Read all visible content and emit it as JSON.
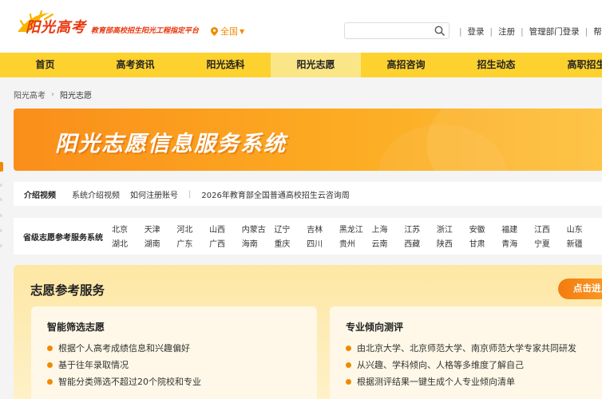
{
  "header": {
    "logo_title": "阳光高考",
    "logo_subtitle": "教育部高校招生阳光工程指定平台",
    "region": "全国",
    "search_placeholder": "",
    "links": [
      "登录",
      "注册",
      "管理部门登录",
      "帮助中心"
    ]
  },
  "nav": {
    "items": [
      "首页",
      "高考资讯",
      "阳光选科",
      "阳光志愿",
      "高招咨询",
      "招生动态",
      "高职招生"
    ],
    "active_index": 3
  },
  "breadcrumb": [
    "阳光高考",
    "阳光志愿"
  ],
  "banner": {
    "title": "阳光志愿信息服务系统"
  },
  "video": {
    "label": "介绍视频",
    "links": [
      "系统介绍视频",
      "如何注册账号"
    ],
    "extra": "2026年教育部全国普通高校招生云咨询周"
  },
  "province": {
    "label": "省级志愿参考服务系统",
    "row1": [
      "北京",
      "天津",
      "河北",
      "山西",
      "内蒙古",
      "辽宁",
      "吉林",
      "黑龙江",
      "上海",
      "江苏",
      "浙江",
      "安徽",
      "福建",
      "江西",
      "山东"
    ],
    "row2": [
      "湖北",
      "湖南",
      "广东",
      "广西",
      "海南",
      "重庆",
      "四川",
      "贵州",
      "云南",
      "西藏",
      "陕西",
      "甘肃",
      "青海",
      "宁夏",
      "新疆"
    ]
  },
  "service": {
    "title": "志愿参考服务",
    "enter_button": "点击进入",
    "card1": {
      "title": "智能筛选志愿",
      "items": [
        "根据个人高考成绩信息和兴趣偏好",
        "基于往年录取情况",
        "智能分类筛选不超过20个院校和专业"
      ]
    },
    "card2": {
      "title": "专业倾向测评",
      "items": [
        "由北京大学、北京师范大学、南京师范大学专家共同研发",
        "从兴趣、学科倾向、人格等多维度了解自己",
        "根据测评结果一键生成个人专业倾向清单"
      ]
    }
  },
  "colors": {
    "brand_red": "#e8380d",
    "nav_yellow": "#fdd22e",
    "accent_orange": "#f08a00"
  }
}
